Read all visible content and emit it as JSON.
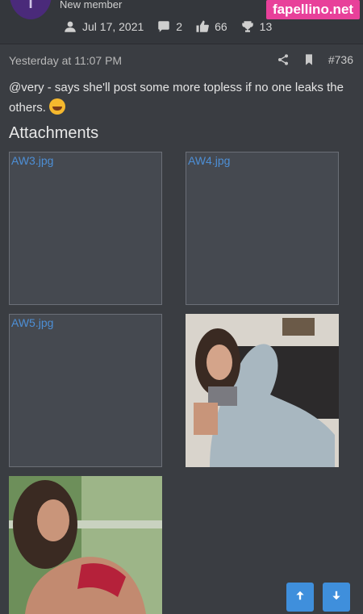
{
  "member": {
    "avatar_letter": "T",
    "role": "New member",
    "joined": "Jul 17, 2021",
    "messages": "2",
    "reactions": "66",
    "points": "13"
  },
  "watermark": "fapellino.net",
  "post": {
    "timestamp": "Yesterday at 11:07 PM",
    "number": "#736",
    "text": "@very - says she'll post some more topless if no one leaks the others."
  },
  "attachments": {
    "title": "Attachments",
    "files": [
      "AW3.jpg",
      "AW4.jpg",
      "AW5.jpg"
    ]
  },
  "icons": [
    "user-icon",
    "comments-icon",
    "thumbs-up-icon",
    "trophy-icon",
    "share-icon",
    "bookmark-icon",
    "arrow-up-icon",
    "arrow-down-icon"
  ],
  "colors": {
    "accent": "#3f8fdc",
    "link": "#4d8fd6",
    "watermark_bg": "#e8409a",
    "avatar_bg": "#4a2a7a"
  }
}
